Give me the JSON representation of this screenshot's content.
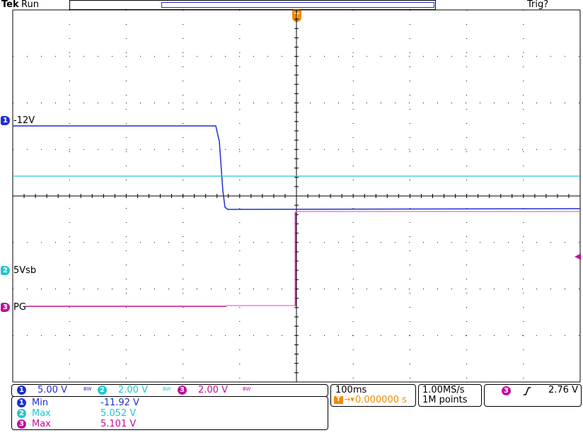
{
  "header": {
    "brand": "Tek",
    "status": "Run",
    "trigger_status": "Trig?"
  },
  "trigger_marker": "T",
  "colors": {
    "ch1": "#1f2fd0",
    "ch2": "#20c8d0",
    "ch3": "#c0109c",
    "ch3_light": "#f060e0",
    "trigger": "#f08c00",
    "grid": "#000000"
  },
  "channels": [
    {
      "number": "1",
      "label": "-12V"
    },
    {
      "number": "2",
      "label": "5Vsb"
    },
    {
      "number": "3",
      "label": "PG"
    }
  ],
  "scales": [
    {
      "channel": "1",
      "value": "5.00 V",
      "bw": "BW"
    },
    {
      "channel": "2",
      "value": "2.00 V",
      "bw": "BW"
    },
    {
      "channel": "3",
      "value": "2.00 V",
      "bw": "BW"
    }
  ],
  "measurements": [
    {
      "channel": "1",
      "name": "Min",
      "value": "-11.92 V"
    },
    {
      "channel": "2",
      "name": "Max",
      "value": "5.052 V"
    },
    {
      "channel": "3",
      "name": "Max",
      "value": "5.101 V"
    }
  ],
  "timebase": {
    "horizontal": "100ms",
    "trigger_position": "0.000000 s",
    "sample_rate": "1.00MS/s",
    "record_length": "1M points"
  },
  "trigger": {
    "channel": "3",
    "slope_icon": "rising-edge-icon",
    "level": "2.76 V"
  }
}
